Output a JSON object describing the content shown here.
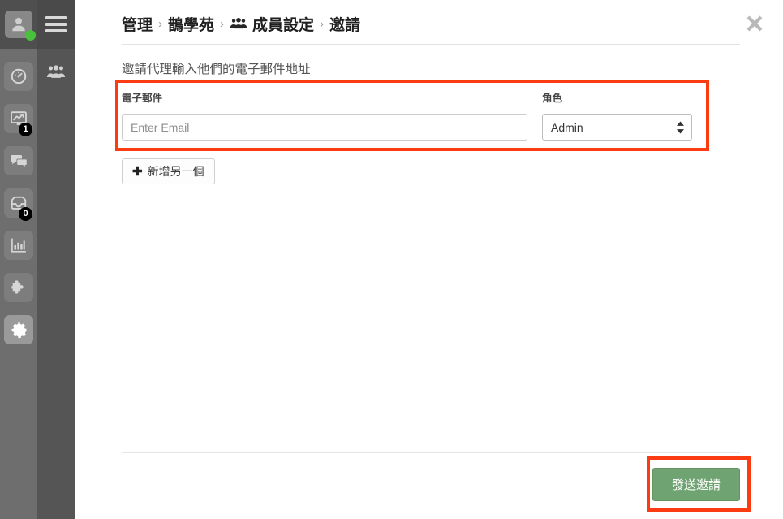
{
  "sidebar": {
    "avatar": {
      "name": "user-avatar",
      "status": "online"
    },
    "items": [
      {
        "icon": "dashboard-gauge-icon",
        "badge": null
      },
      {
        "icon": "analytics-monitor-icon",
        "badge": "1"
      },
      {
        "icon": "chat-bubbles-icon",
        "badge": null
      },
      {
        "icon": "inbox-tray-icon",
        "badge": "0"
      },
      {
        "icon": "bar-chart-icon",
        "badge": null
      },
      {
        "icon": "puzzle-piece-icon",
        "badge": null
      },
      {
        "icon": "gear-settings-icon",
        "badge": null,
        "active": true
      }
    ],
    "secondary": {
      "menu_icon": "hamburger-menu-icon",
      "items": [
        {
          "icon": "group-users-icon"
        }
      ]
    }
  },
  "header": {
    "close_icon": "close-x-icon",
    "breadcrumb": [
      {
        "label": "管理"
      },
      {
        "label": "鵲學苑"
      },
      {
        "label": "成員設定",
        "icon": "group-users-icon"
      },
      {
        "label": "邀請"
      }
    ],
    "separator": "›"
  },
  "main": {
    "intro": "邀請代理輸入他們的電子郵件地址",
    "email_field": {
      "label": "電子郵件",
      "placeholder": "Enter Email",
      "value": ""
    },
    "role_field": {
      "label": "角色",
      "selected": "Admin",
      "options": [
        "Admin"
      ]
    },
    "add_another": {
      "plus": "✚",
      "label": "新增另一個"
    },
    "send_button": "發送邀請"
  },
  "colors": {
    "highlight": "#fb3b11",
    "send_button": "#6fa371",
    "rail_primary": "#6e6e6e",
    "rail_secondary": "#555555",
    "online_dot": "#49c13c"
  }
}
